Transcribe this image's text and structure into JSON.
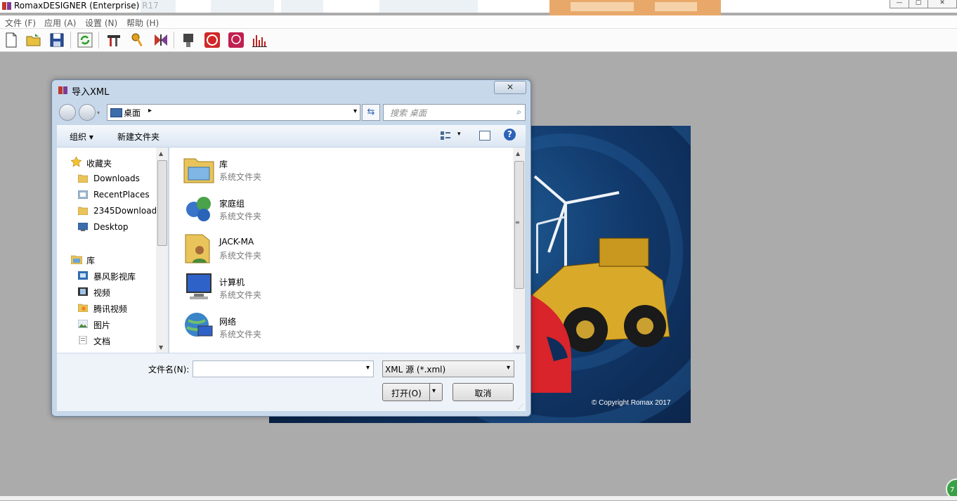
{
  "app": {
    "title": "RomaxDESIGNER (Enterprise) R17"
  },
  "window_controls": {
    "minimize": "—",
    "maximize": "▢",
    "close": "✕"
  },
  "menu": {
    "items": [
      "文件 (F)",
      "应用 (A)",
      "设置 (N)",
      "帮助 (H)"
    ]
  },
  "toolbar": {
    "icons": [
      "new-file-icon",
      "open-folder-icon",
      "save-icon",
      "refresh-icon",
      "tools-icon",
      "key-icon",
      "butterfly-icon",
      "bearing-icon",
      "copyright-tool-icon",
      "dyn-icon",
      "chart-icon"
    ]
  },
  "splash": {
    "copyright": "© Copyright Romax 2017"
  },
  "dialog": {
    "title": "导入XML",
    "close": "✕",
    "address": {
      "location": "桌面",
      "arrow": "▸",
      "dropdown": "▾"
    },
    "refresh_glyph": "⇆",
    "search": {
      "placeholder": "搜索 桌面",
      "icon": "⌕"
    },
    "command_bar": {
      "organize": "组织 ▾",
      "new_folder": "新建文件夹",
      "view_dropdown": "▾",
      "help": "?"
    },
    "nav_pane": {
      "favorites_header": "收藏夹",
      "favorites": [
        "Downloads",
        "RecentPlaces",
        "2345Downloads",
        "Desktop"
      ],
      "libraries_header": "库",
      "libraries": [
        "暴风影视库",
        "视频",
        "腾讯视频",
        "图片",
        "文档"
      ]
    },
    "files": [
      {
        "name": "库",
        "desc": "系统文件夹",
        "icon": "library-folder-icon"
      },
      {
        "name": "家庭组",
        "desc": "系统文件夹",
        "icon": "homegroup-icon"
      },
      {
        "name": "JACK-MA",
        "desc": "系统文件夹",
        "icon": "user-folder-icon"
      },
      {
        "name": "计算机",
        "desc": "系统文件夹",
        "icon": "computer-icon"
      },
      {
        "name": "网络",
        "desc": "系统文件夹",
        "icon": "network-icon"
      }
    ],
    "scroll": {
      "up": "▲",
      "down": "▼",
      "grip": "≡"
    },
    "filename_label": "文件名(N):",
    "filename_value": "",
    "filename_dropdown": "▾",
    "filetype": "XML 源 (*.xml)",
    "filetype_dropdown": "▾",
    "open_button": "打开(O)",
    "open_dropdown": "▾",
    "cancel_button": "取消",
    "resize_grip": "⋰"
  },
  "corner_badge": "7",
  "colors": {
    "workspace": "#ababab",
    "dialog_frame": "#c7d8ea",
    "splash_bg": "#11386a"
  }
}
